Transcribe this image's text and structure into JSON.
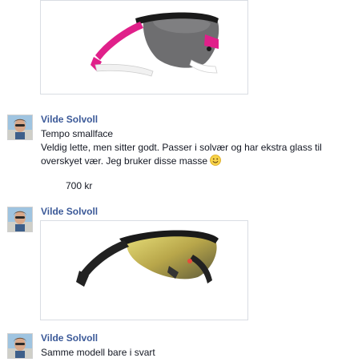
{
  "posts": [
    {
      "image_alt": "pink and white sport sunglasses"
    },
    {
      "author": "Vilde Solvoll",
      "lines": [
        "Tempo smallface",
        "Veldig lette, men sitter godt. Passer i solvær og har ekstra glass til",
        "overskyet vær. Jeg bruker disse masse"
      ],
      "emoji": "smile-emoji",
      "price": "700 kr"
    },
    {
      "author": "Vilde Solvoll",
      "image_alt": "black sport sunglasses with gold mirrored lens"
    },
    {
      "author": "Vilde Solvoll",
      "lines": [
        "Samme modell bare i svart"
      ]
    }
  ],
  "colors": {
    "author_link": "#3b5998",
    "text": "#141823",
    "frame_border": "#d9dde3"
  }
}
